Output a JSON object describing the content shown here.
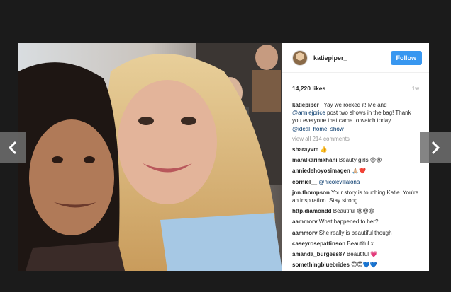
{
  "post": {
    "username": "katiepiper_",
    "follow_label": "Follow",
    "likes": "14,220 likes",
    "time_ago": "1w",
    "caption": {
      "user": "katiepiper_",
      "text_before": " Yay we rocked it! Me and ",
      "mention1": "@anniejprice",
      "text_after": " post two shows in the bag! Thank you everyone that came to watch today ",
      "mention2": "@ideal_home_show"
    },
    "view_all": "view all 214 comments",
    "comments": [
      {
        "user": "sharayvm",
        "text": "",
        "emoji": "👍"
      },
      {
        "user": "maralkarimkhani",
        "text": " Beauty girls ",
        "emoji": "😍😍"
      },
      {
        "user": "anniedehoyosimagen",
        "text": " ",
        "emoji": "🙏🏼❤️"
      },
      {
        "user": "corniel__",
        "text": " ",
        "mention": "@nicolevillalona__",
        "emoji": ""
      },
      {
        "user": "jnn.thompson",
        "text": " Your story is touching Katie. You're an inspiration. Stay strong",
        "emoji": ""
      },
      {
        "user": "http.diamondd",
        "text": " Beautiful ",
        "emoji": "😍😍😍"
      },
      {
        "user": "aammorv",
        "text": " What happened to her?",
        "emoji": ""
      },
      {
        "user": "aammorv",
        "text": " She really is beautiful though",
        "emoji": ""
      },
      {
        "user": "caseyrosepattinson",
        "text": " Beautiful x",
        "emoji": ""
      },
      {
        "user": "amanda_burgess87",
        "text": " Beautiful ",
        "emoji": "💗"
      },
      {
        "user": "somethingbluebrides",
        "text": " ",
        "emoji": "😇😇💙💙"
      }
    ]
  },
  "nav": {
    "prev_icon": "chevron-left-icon",
    "next_icon": "chevron-right-icon"
  },
  "colors": {
    "follow": "#3897f0",
    "mention": "#003569",
    "background": "#1b1b1b"
  }
}
